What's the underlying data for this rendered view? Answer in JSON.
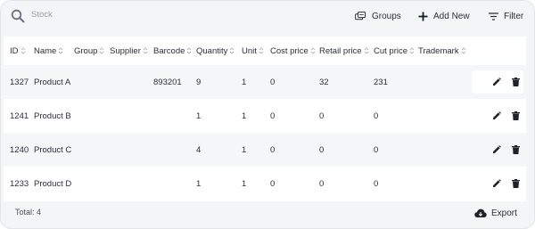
{
  "toolbar": {
    "search_placeholder": "Stock",
    "groups_label": "Groups",
    "add_label": "Add New",
    "filter_label": "Filter"
  },
  "table": {
    "columns": [
      "ID",
      "Name",
      "Group",
      "Supplier",
      "Barcode",
      "Quantity",
      "Unit",
      "Cost price",
      "Retail price",
      "Cut price",
      "Trademark"
    ],
    "rows": [
      {
        "id": "1327",
        "name": "Product A",
        "group": "",
        "supplier": "",
        "barcode": "893201",
        "quantity": "9",
        "unit": "1",
        "cost": "0",
        "retail": "32",
        "cut": "231",
        "trademark": ""
      },
      {
        "id": "1241",
        "name": "Product B",
        "group": "",
        "supplier": "",
        "barcode": "",
        "quantity": "1",
        "unit": "1",
        "cost": "0",
        "retail": "0",
        "cut": "0",
        "trademark": ""
      },
      {
        "id": "1240",
        "name": "Product C",
        "group": "",
        "supplier": "",
        "barcode": "",
        "quantity": "4",
        "unit": "1",
        "cost": "0",
        "retail": "0",
        "cut": "0",
        "trademark": ""
      },
      {
        "id": "1233",
        "name": "Product D",
        "group": "",
        "supplier": "",
        "barcode": "",
        "quantity": "1",
        "unit": "1",
        "cost": "0",
        "retail": "0",
        "cut": "0",
        "trademark": ""
      }
    ]
  },
  "footer": {
    "total_label": "Total: 4",
    "export_label": "Export"
  },
  "colors": {
    "text": "#2b2f38",
    "placeholder": "#9aa0aa",
    "row_shade": "#f5f6f8",
    "background": "#f4f5f7"
  },
  "icons": [
    "search-icon",
    "groups-icon",
    "plus-icon",
    "filter-icon",
    "sort-icon",
    "edit-icon",
    "delete-icon",
    "cloud-download-icon"
  ]
}
